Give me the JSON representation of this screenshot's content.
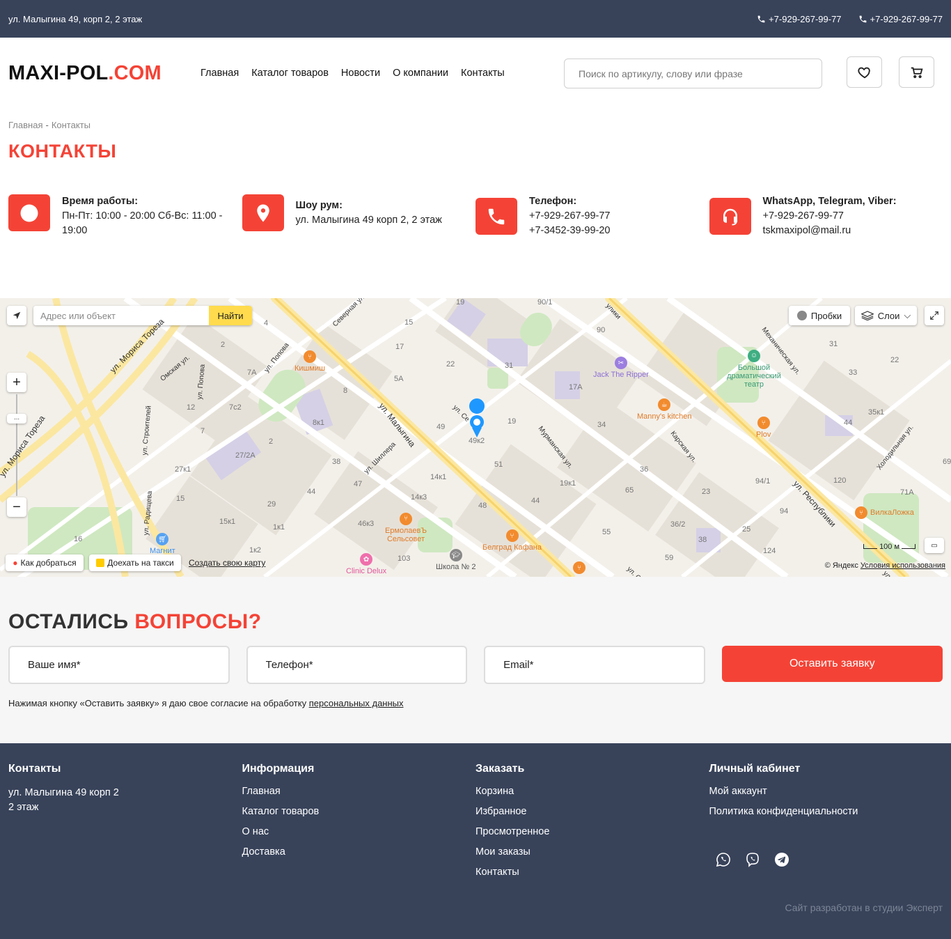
{
  "topbar": {
    "address": "ул. Малыгина 49, корп 2, 2 этаж",
    "phone1": "+7-929-267-99-77",
    "phone2": "+7-929-267-99-77"
  },
  "header": {
    "logo_main": "MAXI-POL",
    "logo_accent": ".COM",
    "nav": [
      "Главная",
      "Каталог товаров",
      "Новости",
      "О компании",
      "Контакты"
    ],
    "search_placeholder": "Поиск по артикулу, слову или фразе"
  },
  "breadcrumb": {
    "home": "Главная",
    "sep": "-",
    "current": "Контакты"
  },
  "page_title": "КОНТАКТЫ",
  "info": {
    "hours": {
      "title": "Время работы:",
      "text": "Пн-Пт: 10:00 - 20:00 Сб-Вс: 11:00 - 19:00"
    },
    "showroom": {
      "title": "Шоу рум:",
      "text": "ул. Малыгина 49 корп 2, 2 этаж"
    },
    "phone": {
      "title": "Телефон:",
      "line1": "+7-929-267-99-77",
      "line2": "+7-3452-39-99-20"
    },
    "messengers": {
      "title": "WhatsApp, Telegram, Viber:",
      "line1": "+7-929-267-99-77",
      "line2": "tskmaxipol@mail.ru"
    }
  },
  "map": {
    "search_placeholder": "Адрес или объект",
    "search_button": "Найти",
    "traffic": "Пробки",
    "layers": "Слои",
    "route": "Как добраться",
    "taxi": "Доехать на такси",
    "create_map": "Создать свою карту",
    "scale": "100 м",
    "attribution": "© Яндекс",
    "terms": "Условия использования",
    "streets": [
      "ул. Мориса Тореза",
      "ул. Мориса Тореза",
      "ул. Малыгина",
      "ул. Попова",
      "ул. Шиллера",
      "Мурманская ул.",
      "Карская ул.",
      "ул. Республики",
      "Механическая ул.",
      "Холодильная ул.",
      "ул. Строителей",
      "ул. Радищева",
      "Омская ул.",
      "Северная ул.",
      "ул. Се",
      "ул. Се",
      "ул. Попова",
      "ул. Рес",
      "улики"
    ],
    "pois": [
      "Кишмиш",
      "Jack The Ripper",
      "Manny's kitchen",
      "Plov",
      "Большой драматический театр",
      "ЕрмолаевЪ Сельсовет",
      "Белград Кафана",
      "Школа № 2",
      "Clinic Delux",
      "Магнит",
      "ВилкаЛожка"
    ],
    "numbers": [
      "19",
      "15",
      "4",
      "2",
      "17",
      "22",
      "31",
      "90/1",
      "90",
      "31",
      "22",
      "33",
      "7А",
      "5А",
      "8",
      "17А",
      "12",
      "7с2",
      "8к1",
      "49",
      "49к2",
      "19",
      "34",
      "35к1",
      "44",
      "7",
      "2",
      "27/2А",
      "38",
      "47",
      "51",
      "14к1",
      "36",
      "19к1",
      "120",
      "94/1",
      "71А",
      "27к1",
      "15",
      "29",
      "44",
      "14к3",
      "48",
      "44",
      "65",
      "23",
      "94",
      "15к1",
      "1к1",
      "46к3",
      "36/2",
      "25",
      "16",
      "1к2",
      "103",
      "55",
      "59",
      "38",
      "124",
      "69"
    ]
  },
  "questions": {
    "title_main": "ОСТАЛИСЬ",
    "title_accent": "ВОПРОСЫ?",
    "name_placeholder": "Ваше имя*",
    "phone_placeholder": "Телефон*",
    "email_placeholder": "Email*",
    "submit": "Оставить заявку",
    "consent_text": "Нажимая кнопку «Оставить заявку» я даю свое согласие на обработку",
    "consent_link": "персональных данных"
  },
  "footer": {
    "contacts": {
      "title": "Контакты",
      "line1": "ул. Малыгина 49 корп 2",
      "line2": "2 этаж"
    },
    "info": {
      "title": "Информация",
      "items": [
        "Главная",
        "Каталог товаров",
        "О нас",
        "Доставка"
      ]
    },
    "order": {
      "title": "Заказать",
      "items": [
        "Корзина",
        "Избранное",
        "Просмотренное",
        "Мои заказы",
        "Контакты"
      ]
    },
    "account": {
      "title": "Личный кабинет",
      "items": [
        "Мой аккаунт",
        "Политика конфиденциальности"
      ]
    },
    "credit": "Сайт разработан в студии Эксперт"
  },
  "colors": {
    "accent": "#f44336",
    "dark": "#38435a",
    "map_yellow": "#ffdb4d"
  },
  "icons": [
    "phone-icon",
    "heart-icon",
    "cart-icon",
    "clock-icon",
    "location-pin-icon",
    "headset-icon",
    "whatsapp-icon",
    "viber-icon",
    "telegram-icon"
  ]
}
